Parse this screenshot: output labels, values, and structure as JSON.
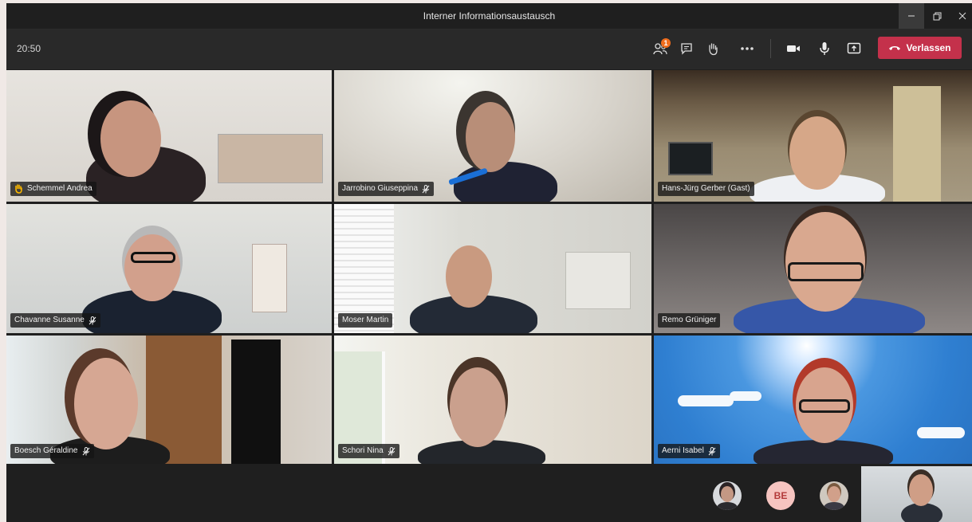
{
  "window": {
    "title": "Interner Informationsaustausch",
    "controls": [
      "minimize-icon",
      "maximize-icon",
      "close-icon"
    ]
  },
  "toolbar": {
    "time": "20:50",
    "participants_badge": "1",
    "leave_label": "Verlassen",
    "colors": {
      "leave": "#c4314b",
      "badge": "#f06d1d",
      "bar": "#292929"
    }
  },
  "tiles": [
    {
      "name": "Schemmel Andrea",
      "hand_raised": true,
      "mic_muted": false
    },
    {
      "name": "Jarrobino Giuseppina",
      "hand_raised": false,
      "mic_muted": true
    },
    {
      "name": "Hans-Jürg Gerber (Gast)",
      "hand_raised": false,
      "mic_muted": false
    },
    {
      "name": "Chavanne Susanne",
      "hand_raised": false,
      "mic_muted": true
    },
    {
      "name": "Moser Martin",
      "hand_raised": false,
      "mic_muted": false
    },
    {
      "name": "Remo Grüniger",
      "hand_raised": false,
      "mic_muted": false
    },
    {
      "name": "Boesch Géraldine",
      "hand_raised": false,
      "mic_muted": true
    },
    {
      "name": "Schori Nina",
      "hand_raised": false,
      "mic_muted": true
    },
    {
      "name": "Aerni Isabel",
      "hand_raised": false,
      "mic_muted": true
    }
  ],
  "bottom": {
    "avatars": [
      {
        "type": "photo"
      },
      {
        "type": "initials",
        "initials": "BE"
      },
      {
        "type": "photo"
      }
    ]
  }
}
